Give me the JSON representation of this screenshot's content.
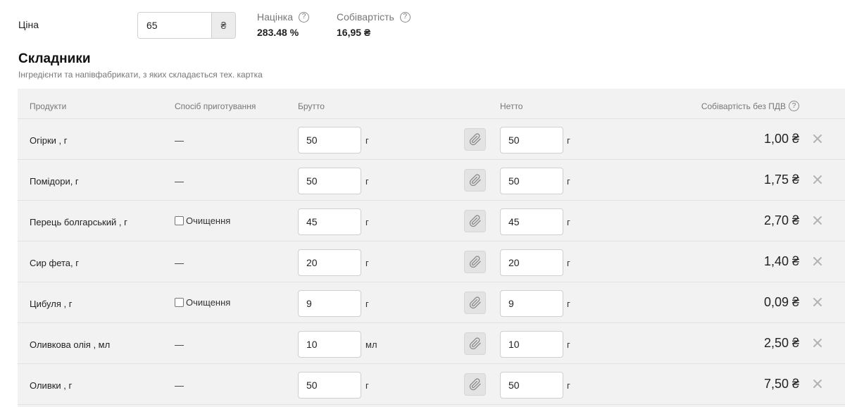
{
  "price": {
    "label": "Ціна",
    "value": "65",
    "currency": "₴"
  },
  "markup": {
    "label": "Націнка",
    "value": "283.48 %"
  },
  "cost_price": {
    "label": "Собівартість",
    "value": "16,95 ₴"
  },
  "help_icon": "question-icon",
  "section": {
    "title": "Складники",
    "subtitle": "Інгредієнти та напівфабрикати, з яких складається тех. картка"
  },
  "table": {
    "headers": {
      "products": "Продукти",
      "method": "Спосіб приготування",
      "gross": "Брутто",
      "net": "Нетто",
      "cost": "Собівартість без ПДВ"
    },
    "rows": [
      {
        "name": "Огірки , г",
        "method": "—",
        "gross": "50",
        "gross_unit": "г",
        "net": "50",
        "net_unit": "г",
        "cost": "1,00 ₴"
      },
      {
        "name": "Помідори, г",
        "method": "—",
        "gross": "50",
        "gross_unit": "г",
        "net": "50",
        "net_unit": "г",
        "cost": "1,75 ₴"
      },
      {
        "name": "Перець болгарський , г",
        "method": "Очищення",
        "method_checkbox": true,
        "gross": "45",
        "gross_unit": "г",
        "net": "45",
        "net_unit": "г",
        "cost": "2,70 ₴"
      },
      {
        "name": "Сир фета, г",
        "method": "—",
        "gross": "20",
        "gross_unit": "г",
        "net": "20",
        "net_unit": "г",
        "cost": "1,40 ₴"
      },
      {
        "name": "Цибуля , г",
        "method": "Очищення",
        "method_checkbox": true,
        "gross": "9",
        "gross_unit": "г",
        "net": "9",
        "net_unit": "г",
        "cost": "0,09 ₴"
      },
      {
        "name": "Оливкова олія , мл",
        "method": "—",
        "gross": "10",
        "gross_unit": "мл",
        "net": "10",
        "net_unit": "г",
        "cost": "2,50 ₴"
      },
      {
        "name": "Оливки , г",
        "method": "—",
        "gross": "50",
        "gross_unit": "г",
        "net": "50",
        "net_unit": "г",
        "cost": "7,50 ₴"
      }
    ]
  },
  "icons": {
    "attach": "paperclip-icon",
    "remove": "close-icon"
  },
  "colors": {
    "panel_bg": "#f2f2f2",
    "muted_text": "#777777",
    "icon_gray": "#b3b3b3"
  }
}
